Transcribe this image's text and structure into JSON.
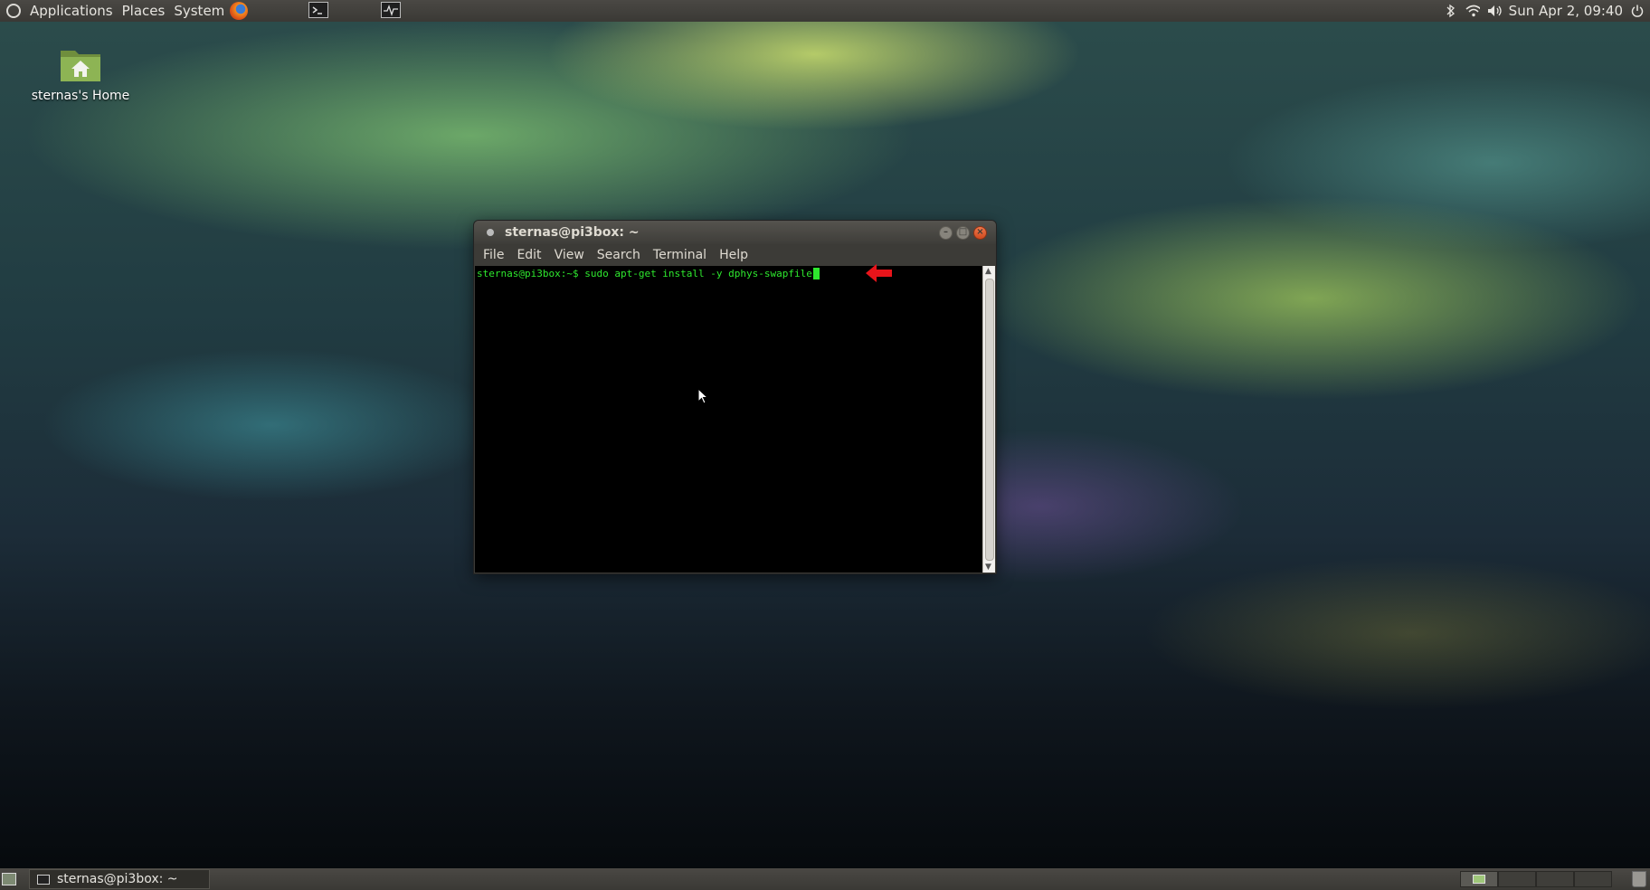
{
  "top_panel": {
    "menus": [
      "Applications",
      "Places",
      "System"
    ],
    "clock": "Sun Apr 2, 09:40",
    "icons": [
      "ubuntu-logo-icon",
      "firefox-icon",
      "terminal-launcher-icon",
      "system-monitor-launcher-icon",
      "bluetooth-icon",
      "wifi-icon",
      "volume-icon",
      "power-icon"
    ]
  },
  "desktop": {
    "home_icon_label": "sternas's Home"
  },
  "terminal": {
    "title": "sternas@pi3box: ~",
    "menu": [
      "File",
      "Edit",
      "View",
      "Search",
      "Terminal",
      "Help"
    ],
    "prompt": "sternas@pi3box:~$ ",
    "command": "sudo apt-get install -y dphys-swapfile",
    "text_color": "#2ee82e",
    "background": "#000000"
  },
  "annotation": {
    "arrow_color": "#e8141a"
  },
  "bottom_panel": {
    "task_label": "sternas@pi3box: ~",
    "workspaces": 4,
    "active_workspace": 1
  }
}
